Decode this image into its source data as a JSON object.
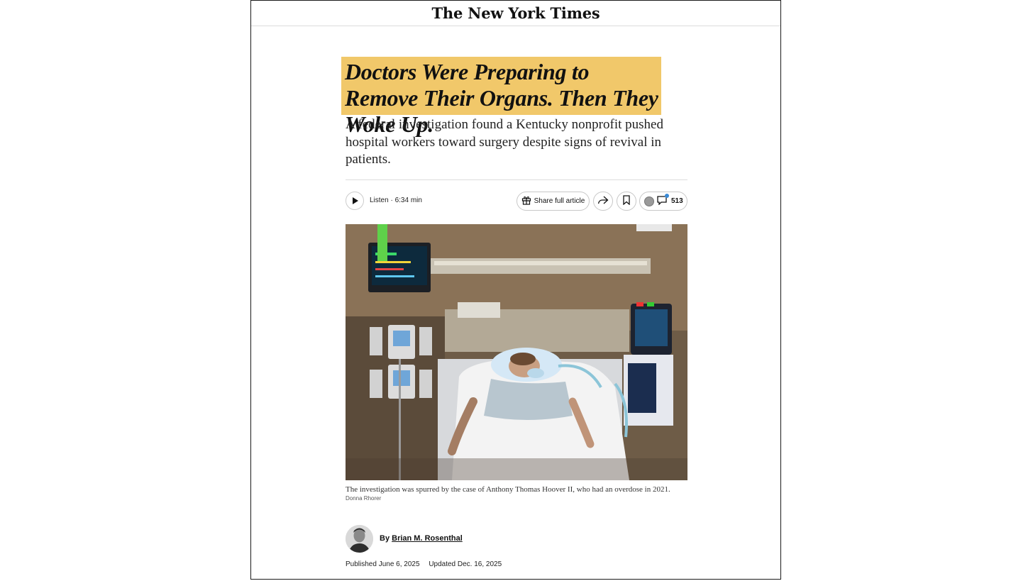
{
  "masthead": {
    "logo_text": "The New York Times"
  },
  "article": {
    "headline": "Doctors Were Preparing to Remove Their Organs. Then They Woke Up.",
    "dek": "A federal investigation found a Kentucky nonprofit pushed hospital workers toward surgery despite signs of revival in patients.",
    "highlight_color": "#f1c86a"
  },
  "toolbar": {
    "listen_label": "Listen · 6:34 min",
    "share_label": "Share full article",
    "comment_count": "513",
    "icons": [
      "play-icon",
      "gift-icon",
      "forward-share-icon",
      "bookmark-icon",
      "comment-icon"
    ]
  },
  "media": {
    "caption": "The investigation was spurred by the case of Anthony Thomas Hoover II, who had an overdose in 2021.",
    "credit": "Donna Rhorer"
  },
  "byline": {
    "prefix": "By",
    "author": "Brian M. Rosenthal"
  },
  "dates": {
    "published": "Published June 6, 2025",
    "updated": "Updated Dec. 16, 2025"
  }
}
